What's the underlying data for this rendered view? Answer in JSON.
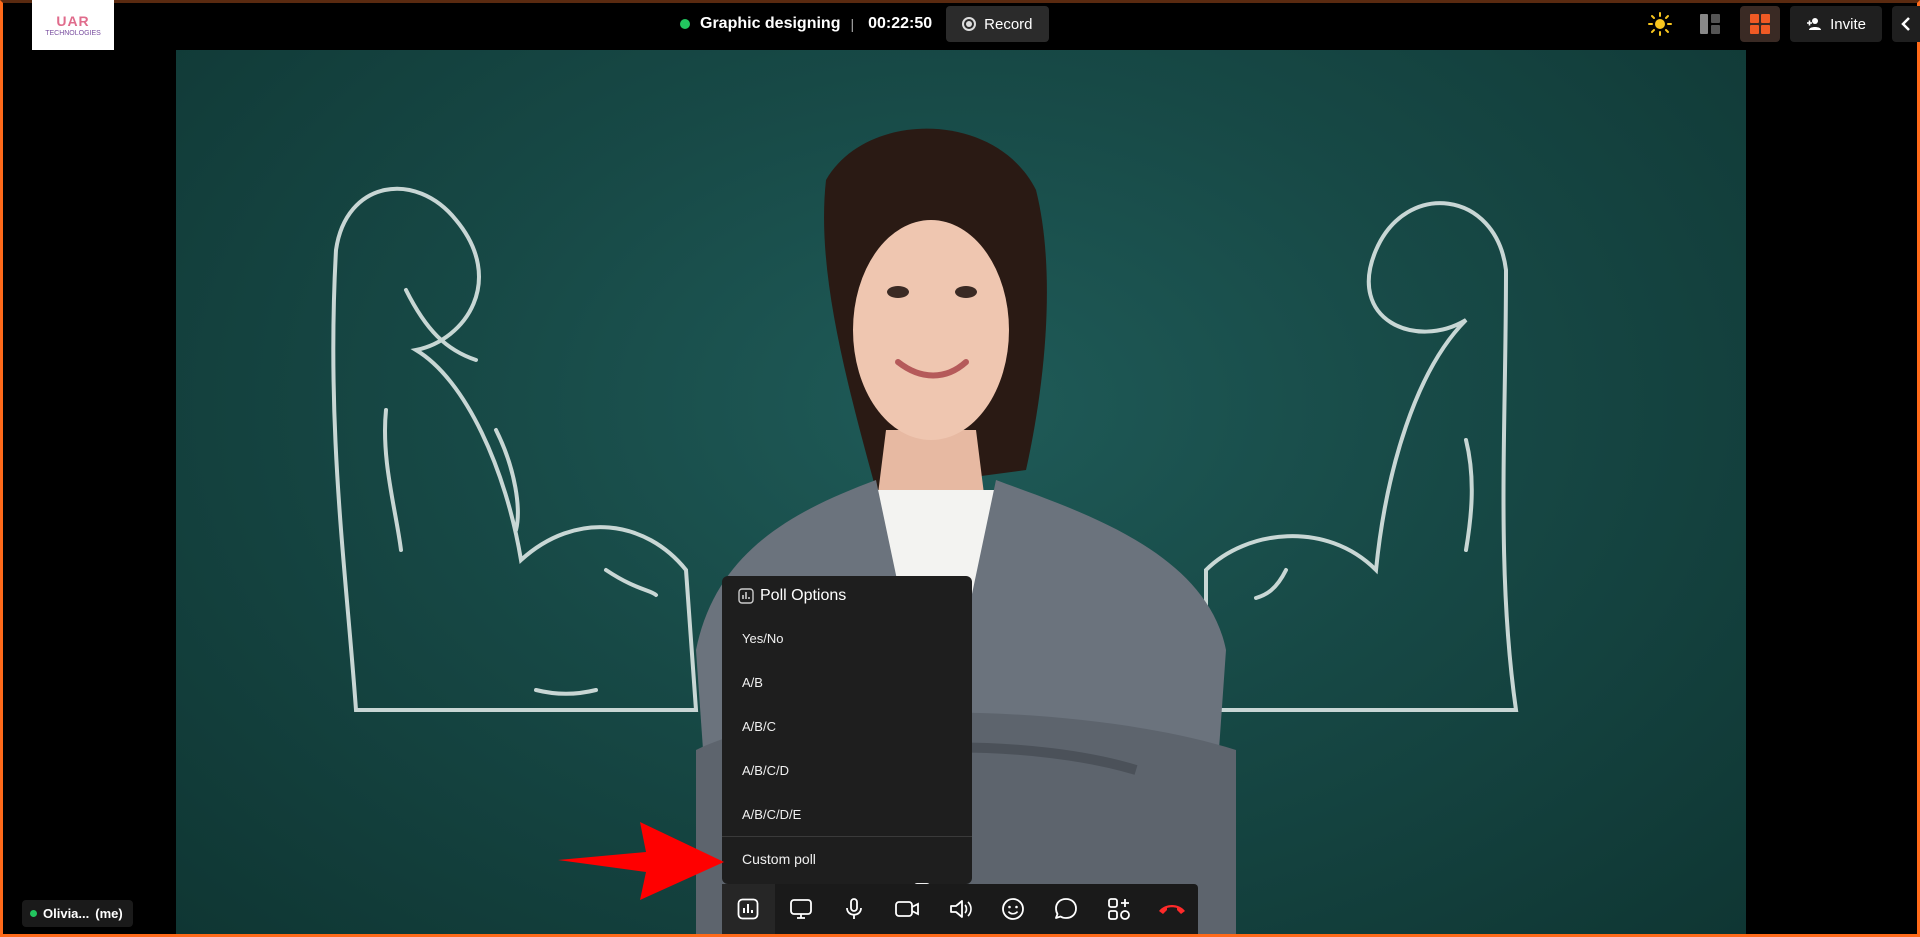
{
  "app": {
    "logo_text_main": "UAR",
    "logo_text_sub": "TECHNOLOGIES"
  },
  "header": {
    "meeting_title": "Graphic designing",
    "separator": "|",
    "timer": "00:22:50",
    "record_label": "Record",
    "invite_label": "Invite",
    "colors": {
      "live": "#22c55e",
      "accent": "#ff6a1a"
    }
  },
  "poll_menu": {
    "title": "Poll Options",
    "options": [
      "Yes/No",
      "A/B",
      "A/B/C",
      "A/B/C/D",
      "A/B/C/D/E"
    ],
    "custom_label": "Custom poll"
  },
  "participant": {
    "name": "Olivia...",
    "suffix": "(me)"
  },
  "toolbar": {
    "icons": [
      "poll-icon",
      "screen-share-icon",
      "microphone-icon",
      "camera-icon",
      "speaker-icon",
      "emoji-icon",
      "chat-icon",
      "apps-icon",
      "end-call-icon"
    ]
  }
}
